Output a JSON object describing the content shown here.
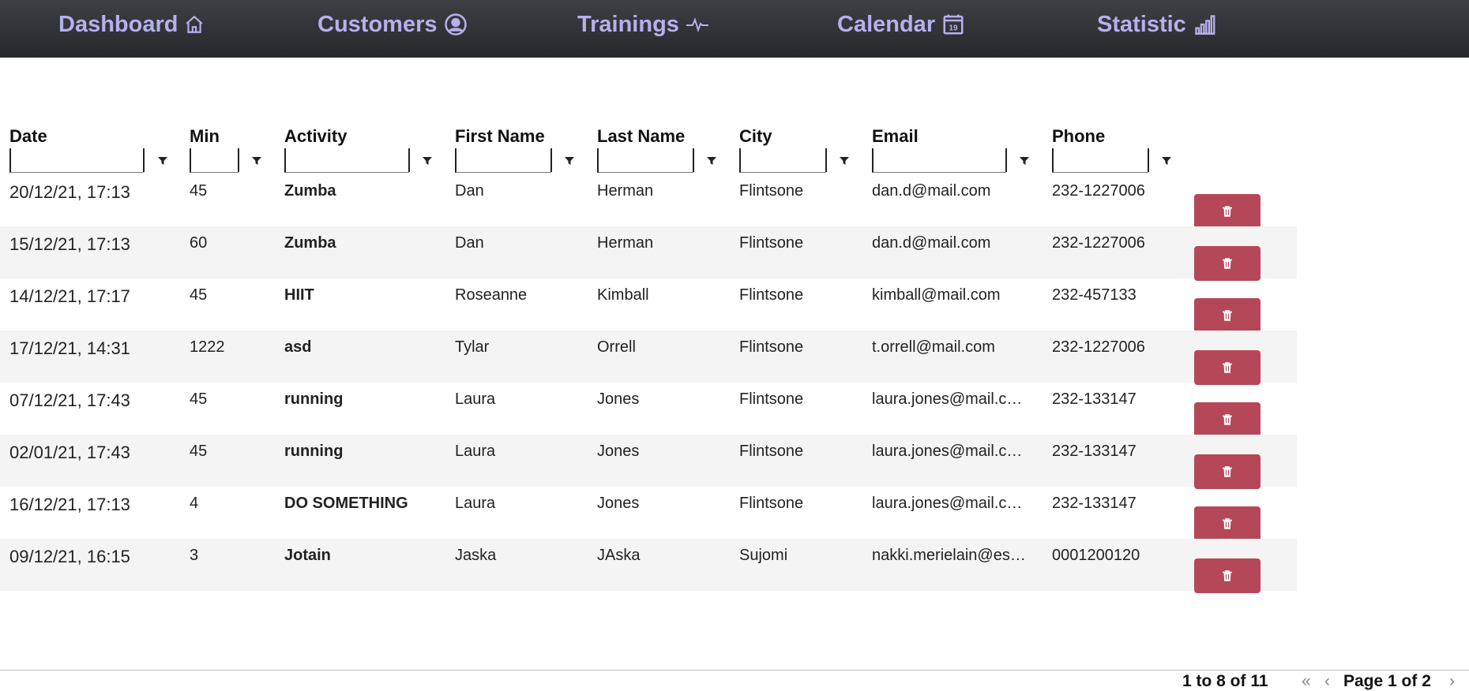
{
  "nav": {
    "items": [
      {
        "label": "Dashboard",
        "icon": "home-icon"
      },
      {
        "label": "Customers",
        "icon": "user-circle-icon"
      },
      {
        "label": "Trainings",
        "icon": "activity-icon"
      },
      {
        "label": "Calendar",
        "icon": "calendar-icon",
        "icon_text": "19"
      },
      {
        "label": "Statistic",
        "icon": "bar-chart-icon"
      }
    ]
  },
  "table": {
    "columns": [
      "Date",
      "Min",
      "Activity",
      "First Name",
      "Last Name",
      "City",
      "Email",
      "Phone"
    ],
    "rows": [
      {
        "date": "20/12/21, 17:13",
        "min": "45",
        "activity": "Zumba",
        "first": "Dan",
        "last": "Herman",
        "city": "Flintsone",
        "email": "dan.d@mail.com",
        "phone": "232-1227006"
      },
      {
        "date": "15/12/21, 17:13",
        "min": "60",
        "activity": "Zumba",
        "first": "Dan",
        "last": "Herman",
        "city": "Flintsone",
        "email": "dan.d@mail.com",
        "phone": "232-1227006"
      },
      {
        "date": "14/12/21, 17:17",
        "min": "45",
        "activity": "HIIT",
        "first": "Roseanne",
        "last": "Kimball",
        "city": "Flintsone",
        "email": "kimball@mail.com",
        "phone": "232-457133"
      },
      {
        "date": "17/12/21, 14:31",
        "min": "1222",
        "activity": "asd",
        "first": "Tylar",
        "last": "Orrell",
        "city": "Flintsone",
        "email": "t.orrell@mail.com",
        "phone": "232-1227006"
      },
      {
        "date": "07/12/21, 17:43",
        "min": "45",
        "activity": "running",
        "first": "Laura",
        "last": "Jones",
        "city": "Flintsone",
        "email": "laura.jones@mail.c…",
        "phone": "232-133147"
      },
      {
        "date": "02/01/21, 17:43",
        "min": "45",
        "activity": "running",
        "first": "Laura",
        "last": "Jones",
        "city": "Flintsone",
        "email": "laura.jones@mail.c…",
        "phone": "232-133147"
      },
      {
        "date": "16/12/21, 17:13",
        "min": "4",
        "activity": "DO SOMETHING",
        "first": "Laura",
        "last": "Jones",
        "city": "Flintsone",
        "email": "laura.jones@mail.c…",
        "phone": "232-133147"
      },
      {
        "date": "09/12/21, 16:15",
        "min": "3",
        "activity": "Jotain",
        "first": "Jaska",
        "last": "JAska",
        "city": "Sujomi",
        "email": "nakki.merielain@es…",
        "phone": "0001200120"
      }
    ],
    "delete_icon": "trash-icon"
  },
  "pagination": {
    "summary": "1 to 8 of 11",
    "page_label": "Page 1 of 2"
  },
  "colors": {
    "nav_text": "#b5b1ec",
    "delete_button": "#b54858",
    "row_alt": "#f4f4f4"
  }
}
